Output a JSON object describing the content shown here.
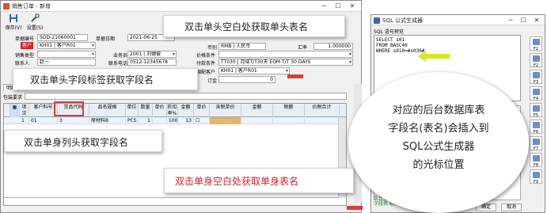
{
  "main_window": {
    "title": "销售订单 - 新增",
    "toolbar": [
      {
        "label": "保存(V)",
        "icon": "save-icon"
      },
      {
        "label": "设置(S)",
        "icon": "settings-icon"
      }
    ],
    "fields": {
      "doc_no_label": "单据编号",
      "doc_no": "SOD-21060001",
      "doc_date_label": "单据日期",
      "doc_date": "2021-06-25",
      "customer_label": "客户",
      "customer": "KH01 | 客户R01",
      "sales_type_label": "销售类型",
      "salesman_label": "业务员",
      "salesman": "2001 | 刘德彼",
      "contact_label": "联系人",
      "contact": "赵一",
      "phone_label": "联系电话",
      "phone": "0512-12345678",
      "currency_label": "币别",
      "currency": "RMB | 人民币",
      "rate_label": "汇率",
      "rate": "1.000000",
      "price_cond_label": "价格条件",
      "pay_cond_label": "付款条件",
      "pay_cond": "TT030 | 月结T/T30天 EOM T/T 30 DAYS",
      "ship_cust_label": "调配客户",
      "ship_cust": "KH01 | 客户R01",
      "deposit_label": "订金",
      "deposit": "0",
      "remark_label": "包装要求"
    },
    "tabs": [
      "明细"
    ],
    "grid": {
      "headers": [
        "项次",
        "客户料号",
        "货品代码",
        "品名规格",
        "单位",
        "数量",
        "单价",
        "折扣率%",
        "金额",
        "单价",
        "含税单价",
        "金额",
        "税额",
        "价税合计"
      ],
      "rows": [
        [
          "1",
          "01",
          "3",
          "原材料B",
          "PCS",
          "1",
          "100",
          "13",
          "",
          "",
          "",
          "",
          "",
          ""
        ]
      ]
    }
  },
  "sql_window": {
    "title": "SQL 公式生成器",
    "preview_label": "SQL 语句预览",
    "sql_lines": [
      "SELECT s01",
      "FROM BASC40",
      "WHERE  s010=#s030#"
    ],
    "right_buttons": [
      "F1",
      "F2",
      "F3",
      "F4",
      "F5",
      "F6",
      "F7",
      "F8",
      "F9"
    ],
    "status_lines": [
      "条件字段参数设置:",
      "字段名 s010, 单身: 3"
    ],
    "ok_label": "确定",
    "cancel_label": "取消"
  },
  "annotations": {
    "header_blank": "双击单头空白处获取单头表名",
    "header_label": "双击单头字段标签获取字段名",
    "grid_column": "双击单身列头获取字段名",
    "body_blank": "双击单身空白处获取单身表名",
    "insert_note": [
      "对应的后台数据库表",
      "字段名(表名)会插入到",
      "SQL公式生成器",
      "的光标位置"
    ]
  },
  "colors": {
    "annotation_red": "#e23a3a",
    "label_red": "#d8222a",
    "arrow_yellow": "#d8e81a",
    "status_green": "#0b8a1c"
  }
}
